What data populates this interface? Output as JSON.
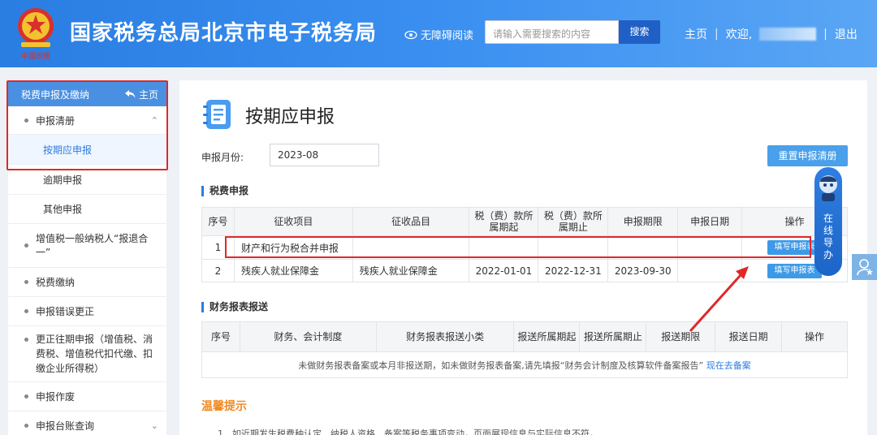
{
  "header": {
    "site_title": "国家税务总局北京市电子税务局",
    "accessibility_label": "无障碍阅读",
    "search_placeholder": "请输入需要搜索的内容",
    "search_button": "搜索",
    "home_link": "主页",
    "welcome": "欢迎,",
    "logout": "退出",
    "emblem_caption": "中國税務"
  },
  "sidebar": {
    "header_title": "税费申报及缴纳",
    "home_label": "主页",
    "items": [
      {
        "label": "申报清册",
        "expanded": true,
        "children": [
          {
            "label": "按期应申报",
            "active": true
          },
          {
            "label": "逾期申报"
          },
          {
            "label": "其他申报"
          }
        ]
      },
      {
        "label": "增值税一般纳税人“报退合一”"
      },
      {
        "label": "税费缴纳"
      },
      {
        "label": "申报错误更正"
      },
      {
        "label": "更正往期申报（增值税、消费税、增值税代扣代缴、扣缴企业所得税）"
      },
      {
        "label": "申报作废"
      },
      {
        "label": "申报台账查询",
        "has_children": true
      }
    ]
  },
  "main": {
    "page_title": "按期应申报",
    "month_label": "申报月份:",
    "month_value": "2023-08",
    "reset_button": "重置申报清册",
    "tax_section": {
      "title": "税费申报",
      "columns": [
        "序号",
        "征收项目",
        "征收品目",
        "税（费）款所属期起",
        "税（费）款所属期止",
        "申报期限",
        "申报日期",
        "操作"
      ],
      "rows": [
        {
          "no": "1",
          "item": "财产和行为税合并申报",
          "subitem": "",
          "start": "",
          "end": "",
          "deadline": "",
          "date": "",
          "action": "填写申报表"
        },
        {
          "no": "2",
          "item": "残疾人就业保障金",
          "subitem": "残疾人就业保障金",
          "start": "2022-01-01",
          "end": "2022-12-31",
          "deadline": "2023-09-30",
          "date": "",
          "action": "填写申报表"
        }
      ]
    },
    "finance_section": {
      "title": "财务报表报送",
      "columns": [
        "序号",
        "财务、会计制度",
        "财务报表报送小类",
        "报送所属期起",
        "报送所属期止",
        "报送期限",
        "报送日期",
        "操作"
      ],
      "notice": "未做财务报表备案或本月非报送期，如未做财务报表备案,请先填报“财务会计制度及核算软件备案报告”",
      "notice_link": "现在去备案"
    },
    "tips": {
      "title": "温馨提示",
      "text": "1、如近期发生税费种认定、纳税人资格、备案等税务事项变动，页面展现信息与实际信息不符，"
    }
  },
  "floating": {
    "online_guide": "在线导办"
  },
  "colors": {
    "header_blue": "#2a7de1",
    "highlight_red": "#e02828",
    "button_blue": "#3d9ae8",
    "tip_orange": "#f08a24"
  }
}
